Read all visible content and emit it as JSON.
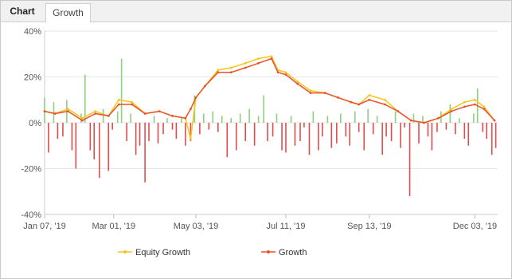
{
  "tabs": [
    {
      "label": "Chart",
      "active": false
    },
    {
      "label": "Growth",
      "active": true
    }
  ],
  "colors": {
    "equity": "#f5c518",
    "growth": "#e8522a",
    "bar_positive": "#8fcf7e",
    "bar_negative": "#e34b4b",
    "grid": "#e6e6e6"
  },
  "chart_data": {
    "type": "line",
    "title": "",
    "xlabel": "",
    "ylabel": "",
    "ylim": [
      -40,
      40
    ],
    "y_ticks": [
      "40%",
      "20%",
      "0%",
      "-20%",
      "-40%"
    ],
    "x_ticks": [
      "Jan 07, '19",
      "Mar 01, '19",
      "May 03, '19",
      "Jul 11, '19",
      "Sep 13, '19",
      "Dec 03, '19"
    ],
    "legend_position": "bottom",
    "series": [
      {
        "name": "Equity Growth",
        "x": [
          "2019-01-07",
          "2019-01-15",
          "2019-01-25",
          "2019-02-05",
          "2019-02-15",
          "2019-02-25",
          "2019-03-05",
          "2019-03-15",
          "2019-03-25",
          "2019-04-05",
          "2019-04-15",
          "2019-04-25",
          "2019-04-29",
          "2019-05-03",
          "2019-05-10",
          "2019-05-20",
          "2019-05-30",
          "2019-06-10",
          "2019-06-20",
          "2019-06-30",
          "2019-07-05",
          "2019-07-11",
          "2019-07-20",
          "2019-07-30",
          "2019-08-10",
          "2019-08-20",
          "2019-08-30",
          "2019-09-05",
          "2019-09-13",
          "2019-09-25",
          "2019-10-05",
          "2019-10-15",
          "2019-10-25",
          "2019-11-05",
          "2019-11-15",
          "2019-11-25",
          "2019-12-03",
          "2019-12-10",
          "2019-12-18"
        ],
        "values": [
          5,
          4,
          6,
          2,
          5,
          3,
          10,
          9,
          4,
          5,
          3,
          2,
          -7,
          11,
          16,
          23,
          24,
          26,
          28,
          29,
          23,
          22,
          18,
          14,
          13,
          11,
          9,
          8,
          12,
          10,
          5,
          1,
          0,
          2,
          6,
          9,
          10,
          7,
          1
        ]
      },
      {
        "name": "Growth",
        "x": [
          "2019-01-07",
          "2019-01-15",
          "2019-01-25",
          "2019-02-05",
          "2019-02-15",
          "2019-02-25",
          "2019-03-05",
          "2019-03-15",
          "2019-03-25",
          "2019-04-05",
          "2019-04-15",
          "2019-04-25",
          "2019-04-29",
          "2019-05-03",
          "2019-05-10",
          "2019-05-20",
          "2019-05-30",
          "2019-06-10",
          "2019-06-20",
          "2019-06-30",
          "2019-07-05",
          "2019-07-11",
          "2019-07-20",
          "2019-07-30",
          "2019-08-10",
          "2019-08-20",
          "2019-08-30",
          "2019-09-05",
          "2019-09-13",
          "2019-09-25",
          "2019-10-05",
          "2019-10-15",
          "2019-10-25",
          "2019-11-05",
          "2019-11-15",
          "2019-11-25",
          "2019-12-03",
          "2019-12-10",
          "2019-12-18"
        ],
        "values": [
          5,
          4,
          5,
          1,
          4,
          3,
          8,
          8,
          4,
          5,
          3,
          2,
          6,
          11,
          16,
          22,
          22,
          24,
          26,
          28,
          22,
          21,
          17,
          13,
          13,
          11,
          9,
          8,
          10,
          8,
          5,
          1,
          0,
          2,
          5,
          7,
          8,
          6,
          1
        ]
      }
    ],
    "bars": {
      "x": [
        "2019-01-07",
        "2019-01-10",
        "2019-01-14",
        "2019-01-17",
        "2019-01-21",
        "2019-01-24",
        "2019-01-28",
        "2019-01-31",
        "2019-02-04",
        "2019-02-07",
        "2019-02-11",
        "2019-02-14",
        "2019-02-18",
        "2019-02-21",
        "2019-02-25",
        "2019-02-28",
        "2019-03-04",
        "2019-03-07",
        "2019-03-11",
        "2019-03-14",
        "2019-03-18",
        "2019-03-21",
        "2019-03-25",
        "2019-03-28",
        "2019-04-01",
        "2019-04-04",
        "2019-04-08",
        "2019-04-11",
        "2019-04-15",
        "2019-04-18",
        "2019-04-22",
        "2019-04-25",
        "2019-04-29",
        "2019-05-02",
        "2019-05-06",
        "2019-05-09",
        "2019-05-13",
        "2019-05-16",
        "2019-05-20",
        "2019-05-23",
        "2019-05-27",
        "2019-05-30",
        "2019-06-03",
        "2019-06-06",
        "2019-06-10",
        "2019-06-13",
        "2019-06-17",
        "2019-06-20",
        "2019-06-24",
        "2019-06-27",
        "2019-07-01",
        "2019-07-04",
        "2019-07-08",
        "2019-07-11",
        "2019-07-15",
        "2019-07-18",
        "2019-07-22",
        "2019-07-25",
        "2019-07-29",
        "2019-08-01",
        "2019-08-05",
        "2019-08-08",
        "2019-08-12",
        "2019-08-15",
        "2019-08-19",
        "2019-08-22",
        "2019-08-26",
        "2019-08-29",
        "2019-09-02",
        "2019-09-05",
        "2019-09-09",
        "2019-09-12",
        "2019-09-16",
        "2019-09-19",
        "2019-09-23",
        "2019-09-26",
        "2019-09-30",
        "2019-10-03",
        "2019-10-07",
        "2019-10-10",
        "2019-10-14",
        "2019-10-17",
        "2019-10-21",
        "2019-10-24",
        "2019-10-28",
        "2019-10-31",
        "2019-11-04",
        "2019-11-07",
        "2019-11-11",
        "2019-11-14",
        "2019-11-18",
        "2019-11-21",
        "2019-11-25",
        "2019-11-28",
        "2019-12-02",
        "2019-12-05",
        "2019-12-09",
        "2019-12-12",
        "2019-12-16",
        "2019-12-19"
      ],
      "values": [
        11,
        -13,
        9,
        -7,
        -6,
        10,
        -12,
        -20,
        4,
        21,
        -12,
        -16,
        -24,
        6,
        -21,
        -3,
        5,
        28,
        -8,
        4,
        -14,
        -10,
        -26,
        -8,
        3,
        -9,
        -5,
        2,
        -3,
        -7,
        2,
        -10,
        -8,
        12,
        -5,
        4,
        -3,
        5,
        -4,
        3,
        -15,
        2,
        -12,
        4,
        -8,
        6,
        -10,
        3,
        12,
        -8,
        -6,
        4,
        -12,
        -13,
        3,
        -10,
        -8,
        -2,
        -14,
        5,
        -12,
        -6,
        3,
        -11,
        -9,
        4,
        -6,
        -10,
        5,
        -4,
        -12,
        6,
        -5,
        3,
        -14,
        -6,
        -8,
        5,
        -11,
        -2,
        -32,
        4,
        -9,
        3,
        -6,
        -12,
        -4,
        5,
        -3,
        8,
        -5,
        2,
        -7,
        -10,
        4,
        15,
        -4,
        -7,
        -14,
        -11
      ]
    }
  },
  "legend": [
    {
      "label": "Equity Growth"
    },
    {
      "label": "Growth"
    }
  ]
}
